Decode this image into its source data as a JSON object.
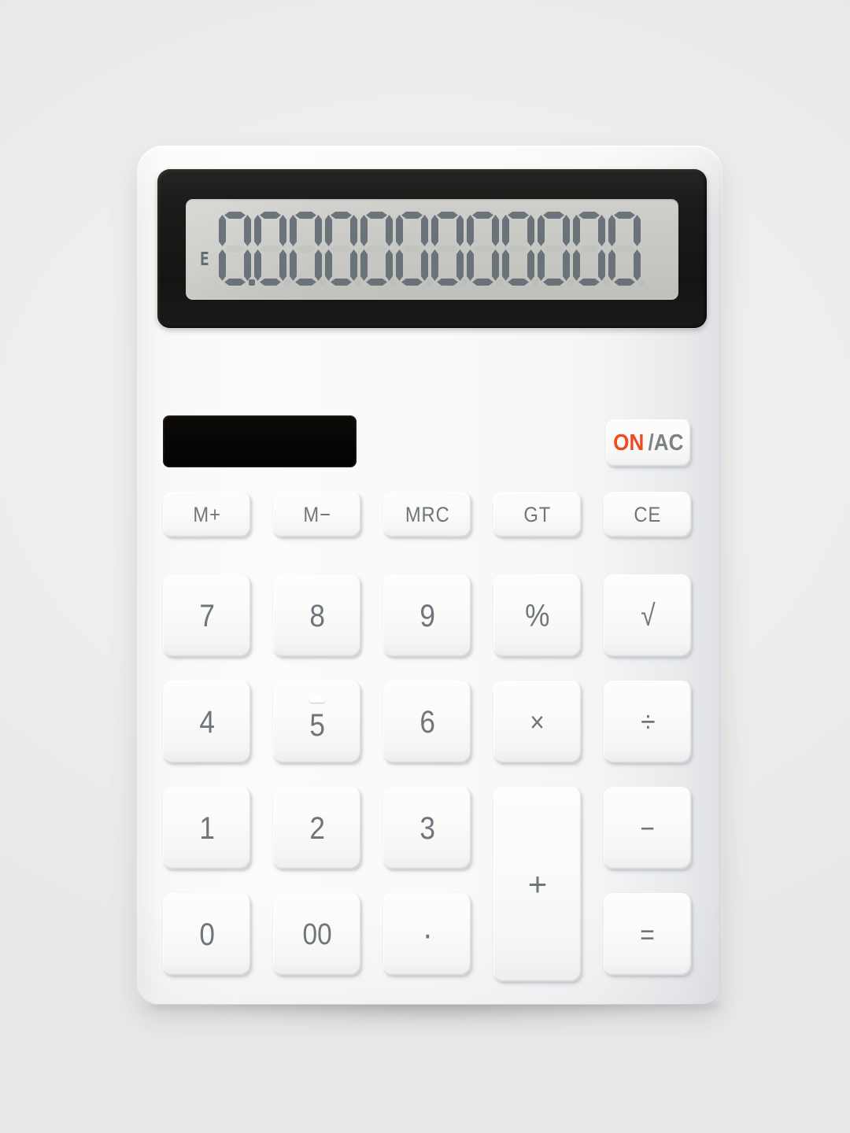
{
  "device": {
    "name": "desktop-calculator",
    "body_color": "#fafafa",
    "accent_color": "#ef4a22",
    "label_color": "#6f757c",
    "background_color": "#eeeeec"
  },
  "display": {
    "name": "lcd-display",
    "bezel_color": "#151413",
    "glass_color": "#c9cac5",
    "segment_color": "#5d6670",
    "digit_count": 12,
    "value": "0.00000000000",
    "digits": [
      "0",
      "0",
      "0",
      "0",
      "0",
      "0",
      "0",
      "0",
      "0",
      "0",
      "0",
      "0"
    ],
    "decimal_after_digit": 1,
    "error_flag": "E",
    "indicators": [
      "E"
    ]
  },
  "solar_panel": {
    "name": "solar-cell-panel",
    "color": "#020202"
  },
  "power": {
    "on_label": "ON",
    "ac_label": "/AC",
    "full_label": "ON/AC"
  },
  "keypad": {
    "function_row": [
      {
        "label": "M+",
        "name": "memory-plus"
      },
      {
        "label": "M−",
        "name": "memory-minus"
      },
      {
        "label": "MRC",
        "name": "memory-recall-clear"
      },
      {
        "label": "GT",
        "name": "grand-total"
      },
      {
        "label": "CE",
        "name": "clear-entry"
      }
    ],
    "row_two": [
      {
        "label": "7",
        "name": "digit-7"
      },
      {
        "label": "8",
        "name": "digit-8"
      },
      {
        "label": "9",
        "name": "digit-9"
      },
      {
        "label": "%",
        "name": "percent"
      },
      {
        "label": "√",
        "name": "square-root"
      }
    ],
    "row_three": [
      {
        "label": "4",
        "name": "digit-4"
      },
      {
        "label": "5",
        "name": "digit-5",
        "home_nub": true
      },
      {
        "label": "6",
        "name": "digit-6"
      },
      {
        "label": "×",
        "name": "multiply"
      },
      {
        "label": "÷",
        "name": "divide"
      }
    ],
    "row_four": [
      {
        "label": "1",
        "name": "digit-1"
      },
      {
        "label": "2",
        "name": "digit-2"
      },
      {
        "label": "3",
        "name": "digit-3"
      }
    ],
    "row_five": [
      {
        "label": "0",
        "name": "digit-0"
      },
      {
        "label": "00",
        "name": "double-zero"
      },
      {
        "label": "·",
        "name": "decimal-point"
      }
    ],
    "plus": {
      "label": "+",
      "name": "add"
    },
    "minus": {
      "label": "−",
      "name": "subtract"
    },
    "equals": {
      "label": "=",
      "name": "equals"
    }
  }
}
